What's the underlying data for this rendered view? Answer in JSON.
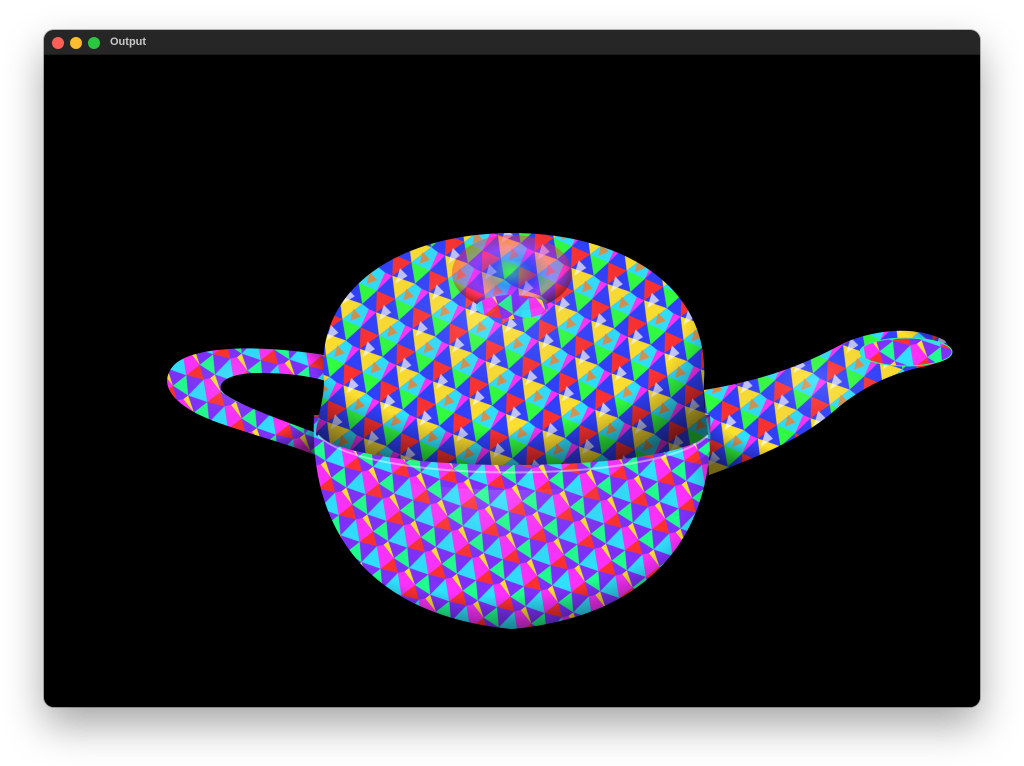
{
  "window": {
    "title": "Output",
    "controls": {
      "close_color": "#fe5f57",
      "minimize_color": "#febc2e",
      "zoom_color": "#28c840"
    }
  },
  "viewport": {
    "background": "#000000",
    "render_subject": "teapot",
    "palette": [
      "#ff3030",
      "#30ff40",
      "#3040ff",
      "#ffe030",
      "#ff30ff",
      "#30e0ff",
      "#ffffff",
      "#ff8020",
      "#8030ff",
      "#20ff90"
    ]
  }
}
